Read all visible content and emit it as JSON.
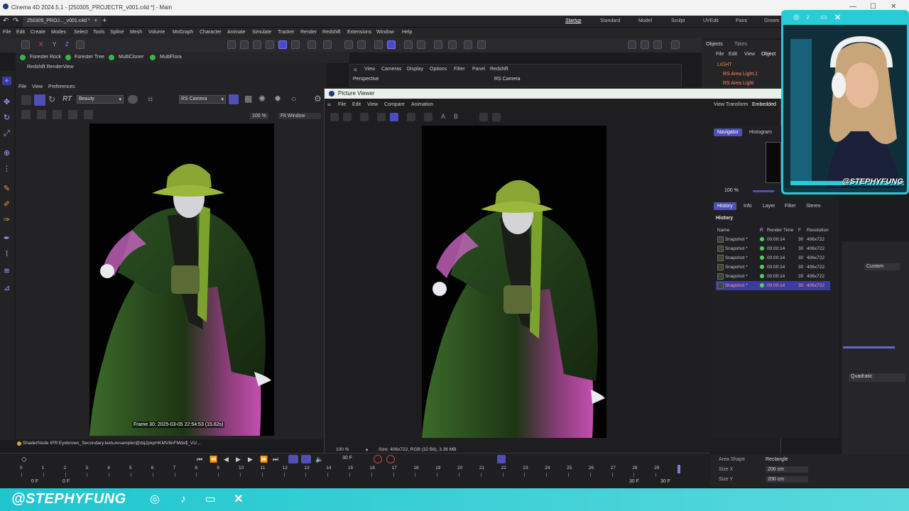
{
  "window": {
    "title": "Cinema 4D 2024.5.1 - [250305_PROJECTR_v001.c4d *] - Main",
    "tab_label": "250305_PROJ..._v001.c4d *"
  },
  "menu": [
    "File",
    "Edit",
    "Create",
    "Modes",
    "Select",
    "Tools",
    "Spline",
    "Mesh",
    "Volume",
    "MoGraph",
    "Character",
    "Animate",
    "Simulate",
    "Tracker",
    "Render",
    "Redshift",
    "Extensions",
    "Window",
    "Help"
  ],
  "layouts": [
    "Startup",
    "Standard",
    "Model",
    "Sculpt",
    "UVEdit",
    "Paint",
    "Groom"
  ],
  "forester": [
    "Forester Rock",
    "Forester Tree",
    "MultiCloner",
    "MultiFlora"
  ],
  "rs_view": {
    "title": "Redshift RenderView",
    "menu": [
      "File",
      "View",
      "Preferences"
    ],
    "aov": "Beauty",
    "camera": "RS Camera",
    "zoom": "100 %",
    "fit": "Fit Window",
    "stamp": "Frame 30:  2025-03-05  22:54:53  (15.62s)",
    "rt_label": "RT"
  },
  "viewport": {
    "menu": [
      "View",
      "Cameras",
      "Display",
      "Options",
      "Filter",
      "Panel",
      "Redshift"
    ],
    "name": "Perspective",
    "camera": "RS Camera"
  },
  "objects": {
    "tabs": [
      "Objects",
      "Takes"
    ],
    "menu": [
      "File",
      "Edit",
      "View",
      "Object"
    ],
    "items": [
      "LIGHT",
      "RS Area Light.1",
      "RS Area Light"
    ]
  },
  "picture_viewer": {
    "title": "Picture Viewer",
    "menu": [
      "File",
      "Edit",
      "View",
      "Compare",
      "Animation"
    ],
    "view_transform_label": "View Transform",
    "view_transform_value": "Embedded",
    "tabs_top": [
      "Navigator",
      "Histogram"
    ],
    "zoom": "100 %",
    "tabs": [
      "History",
      "Info",
      "Layer",
      "Filter",
      "Stereo"
    ],
    "history_heading": "History",
    "columns": [
      "Name",
      "R",
      "Render Time",
      "F",
      "Resolution"
    ],
    "rows": [
      {
        "name": "Snapshot *",
        "time": "00:00:14",
        "f": "30",
        "res": "406x722"
      },
      {
        "name": "Snapshot *",
        "time": "00:00:14",
        "f": "30",
        "res": "406x722"
      },
      {
        "name": "Snapshot *",
        "time": "00:00:14",
        "f": "30",
        "res": "406x722"
      },
      {
        "name": "Snapshot *",
        "time": "00:00:14",
        "f": "30",
        "res": "406x722"
      },
      {
        "name": "Snapshot *",
        "time": "00:00:14",
        "f": "30",
        "res": "406x722"
      },
      {
        "name": "Snapshot *",
        "time": "00:00:14",
        "f": "30",
        "res": "406x722"
      }
    ],
    "status_zoom": "100 %",
    "status_info": "Size: 406x722, RGB (32 Bit), 3.36 MB"
  },
  "shader_line": "ShaderNode IPR:Eyebrows_Secondary.texturesampler@dq2pkpHKMV8nFMdx$_VU...",
  "attributes": {
    "custom": "Custom",
    "quadratic": "Quadratic",
    "area_shape_label": "Area Shape",
    "area_shape_value": "Rectangle",
    "size_x_label": "Size X",
    "size_x_value": "200 cm",
    "size_y_label": "Size Y",
    "size_y_value": "200 cm"
  },
  "timeline": {
    "ticks": [
      "0",
      "1",
      "2",
      "3",
      "4",
      "5",
      "6",
      "7",
      "8",
      "9",
      "10",
      "11",
      "12",
      "13",
      "14",
      "15",
      "16",
      "17",
      "18",
      "19",
      "20",
      "21",
      "22",
      "23",
      "24",
      "25",
      "26",
      "27",
      "28",
      "29"
    ],
    "start": "0 F",
    "start2": "0 F",
    "end": "30 F",
    "end2": "30 F",
    "current": "30 F"
  },
  "streamer": {
    "handle": "@STEPHYFUNG",
    "cam_handle": "@STEPHYFUNG"
  },
  "colors": {
    "accent": "#4f4fb5",
    "social_bar": "#29cbd6",
    "highlight_text": "#ff9b9b"
  }
}
